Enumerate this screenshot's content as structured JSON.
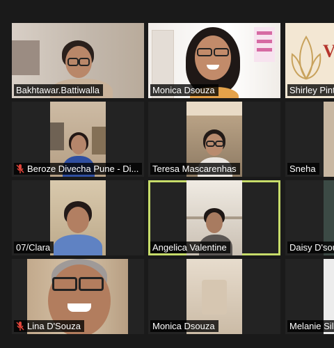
{
  "participants": [
    {
      "name": "Bakhtawar.Battiwalla",
      "muted": false
    },
    {
      "name": "Monica Dsouza",
      "muted": false
    },
    {
      "name": "Shirley Pint",
      "muted": false
    },
    {
      "name": "Beroze Divecha Pune - Di...",
      "muted": true
    },
    {
      "name": "Teresa Mascarenhas",
      "muted": false
    },
    {
      "name": "Sneha",
      "muted": false
    },
    {
      "name": "07/Clara",
      "muted": false
    },
    {
      "name": "Angelica Valentine",
      "muted": false,
      "active_speaker": true
    },
    {
      "name": "Daisy D'sou",
      "muted": false
    },
    {
      "name": "Lina D'Souza",
      "muted": true
    },
    {
      "name": "Monica Dsouza",
      "muted": false
    },
    {
      "name": "Melanie Sil",
      "muted": false
    }
  ],
  "background_logo": {
    "text": "V"
  },
  "colors": {
    "active_border": "#c7dc6a",
    "mute_icon": "#e0443a",
    "background": "#1a1a1a"
  }
}
